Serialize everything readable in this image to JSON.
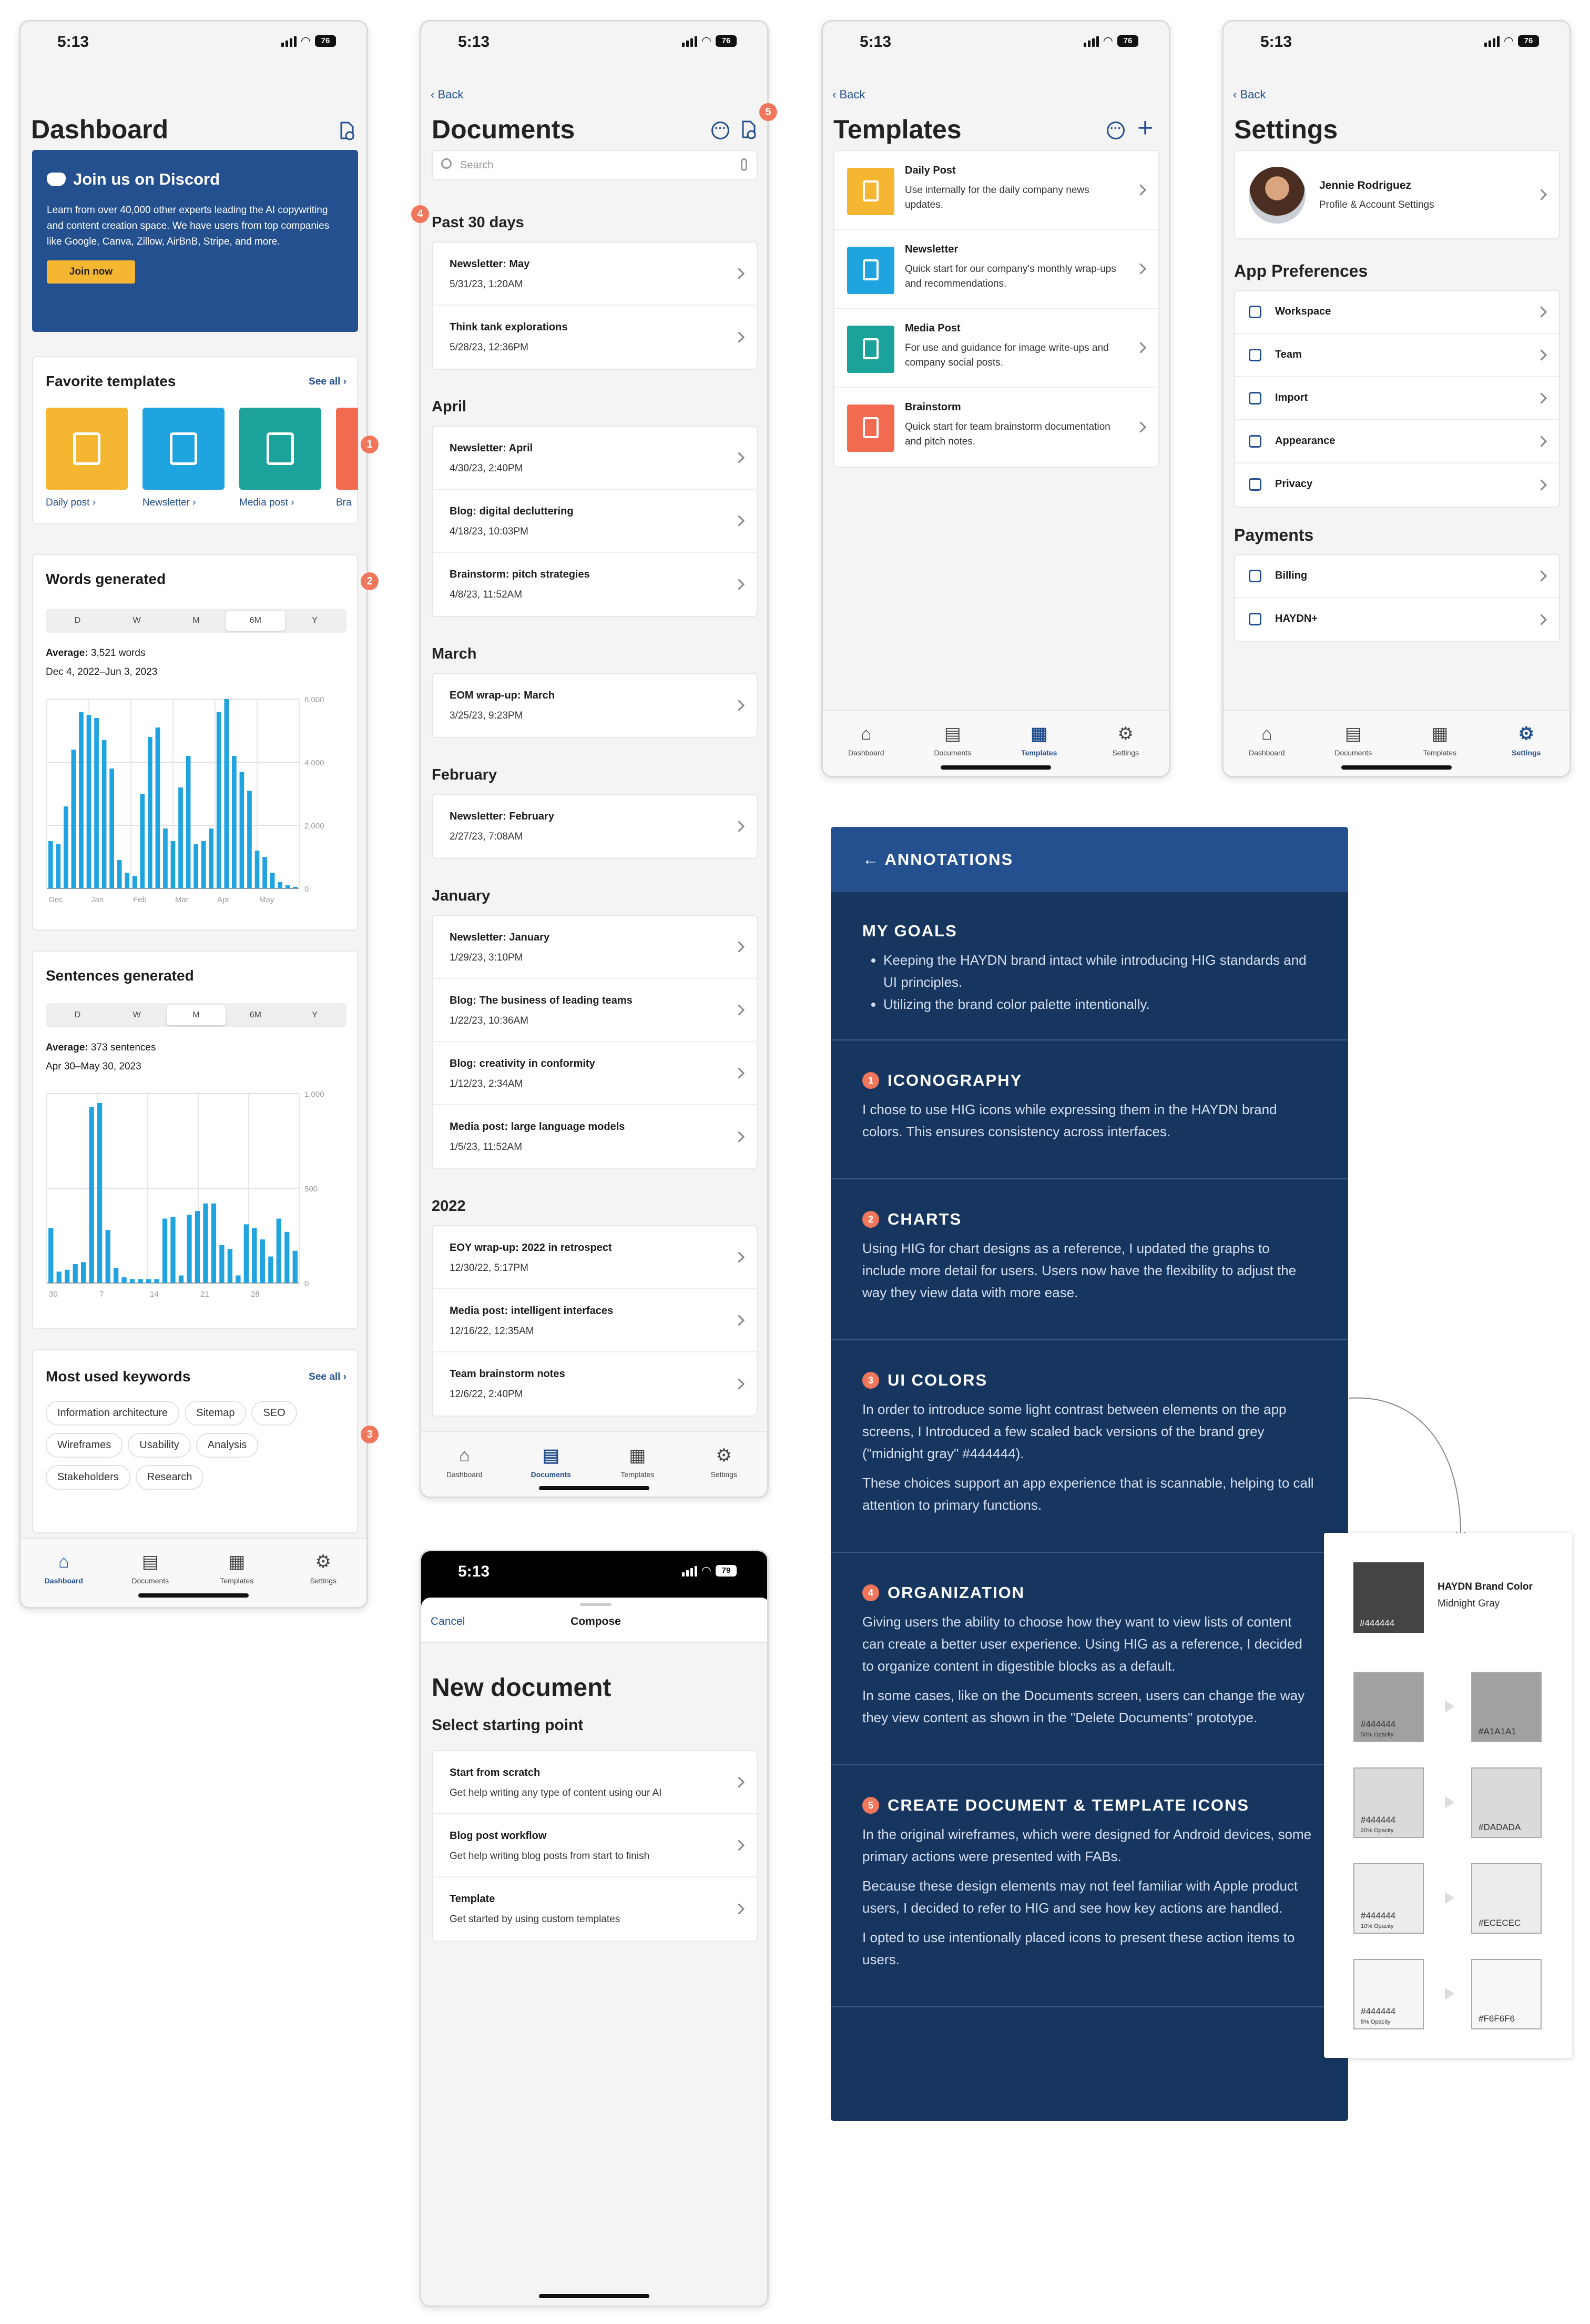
{
  "status": {
    "time": "5:13",
    "battery": "76",
    "battery_alt": "79"
  },
  "badges": [
    "1",
    "2",
    "3",
    "4",
    "5"
  ],
  "dashboard": {
    "title": "Dashboard",
    "discord": {
      "title": "Join us on Discord",
      "body": "Learn from over 40,000 other experts leading the AI copywriting and content creation space. We have users from top companies like Google, Canva, Zillow, AirBnB, Stripe, and more.",
      "button": "Join now"
    },
    "favorites": {
      "title": "Favorite templates",
      "see_all": "See all",
      "items": [
        "Daily post",
        "Newsletter",
        "Media post",
        "Bra"
      ]
    },
    "words": {
      "title": "Words generated",
      "segments": [
        "D",
        "W",
        "M",
        "6M",
        "Y"
      ],
      "selected": "6M",
      "avg_label": "Average:",
      "avg_value": "3,521 words",
      "range": "Dec 4, 2022–Jun 3, 2023"
    },
    "sentences": {
      "title": "Sentences generated",
      "segments": [
        "D",
        "W",
        "M",
        "6M",
        "Y"
      ],
      "selected": "M",
      "avg_label": "Average:",
      "avg_value": "373 sentences",
      "range": "Apr 30–May 30, 2023"
    },
    "keywords": {
      "title": "Most used keywords",
      "see_all": "See all",
      "chips": [
        "Information architecture",
        "Sitemap",
        "SEO",
        "Wireframes",
        "Usability",
        "Analysis",
        "Stakeholders",
        "Research"
      ]
    }
  },
  "tabs": [
    "Dashboard",
    "Documents",
    "Templates",
    "Settings"
  ],
  "documents": {
    "back": "Back",
    "title": "Documents",
    "search_placeholder": "Search",
    "groups": [
      {
        "title": "Past 30 days",
        "items": [
          {
            "t": "Newsletter: May",
            "d": "5/31/23, 1:20AM"
          },
          {
            "t": "Think tank explorations",
            "d": "5/28/23, 12:36PM"
          }
        ]
      },
      {
        "title": "April",
        "items": [
          {
            "t": "Newsletter: April",
            "d": "4/30/23, 2:40PM"
          },
          {
            "t": "Blog: digital decluttering",
            "d": "4/18/23, 10:03PM"
          },
          {
            "t": "Brainstorm: pitch strategies",
            "d": "4/8/23, 11:52AM"
          }
        ]
      },
      {
        "title": "March",
        "items": [
          {
            "t": "EOM wrap-up: March",
            "d": "3/25/23, 9:23PM"
          }
        ]
      },
      {
        "title": "February",
        "items": [
          {
            "t": "Newsletter: February",
            "d": "2/27/23, 7:08AM"
          }
        ]
      },
      {
        "title": "January",
        "items": [
          {
            "t": "Newsletter: January",
            "d": "1/29/23, 3:10PM"
          },
          {
            "t": "Blog: The business of leading teams",
            "d": "1/22/23, 10:36AM"
          },
          {
            "t": "Blog: creativity in conformity",
            "d": "1/12/23, 2:34AM"
          },
          {
            "t": "Media post: large language models",
            "d": "1/5/23, 11:52AM"
          }
        ]
      },
      {
        "title": "2022",
        "items": [
          {
            "t": "EOY wrap-up: 2022 in retrospect",
            "d": "12/30/22, 5:17PM"
          },
          {
            "t": "Media post: intelligent interfaces",
            "d": "12/16/22, 12:35AM"
          },
          {
            "t": "Team brainstorm notes",
            "d": "12/6/22, 2:40PM"
          }
        ]
      }
    ]
  },
  "templates": {
    "back": "Back",
    "title": "Templates",
    "items": [
      {
        "t": "Daily Post",
        "d": "Use internally for the daily company news updates.",
        "color": "#f5b731"
      },
      {
        "t": "Newsletter",
        "d": "Quick start for our company's monthly wrap-ups and recommendations.",
        "color": "#1fa4df"
      },
      {
        "t": "Media Post",
        "d": "For use and guidance for image write-ups and company social posts.",
        "color": "#1aa29b"
      },
      {
        "t": "Brainstorm",
        "d": "Quick start for team brainstorm documentation and pitch notes.",
        "color": "#f26b50"
      }
    ]
  },
  "settings": {
    "back": "Back",
    "title": "Settings",
    "profile": {
      "name": "Jennie Rodriguez",
      "sub": "Profile & Account Settings"
    },
    "prefs_title": "App Preferences",
    "prefs": [
      "Workspace",
      "Team",
      "Import",
      "Appearance",
      "Privacy"
    ],
    "payments_title": "Payments",
    "payments": [
      "Billing",
      "HAYDN+"
    ]
  },
  "newdoc": {
    "cancel": "Cancel",
    "compose": "Compose",
    "title": "New document",
    "subtitle": "Select starting point",
    "items": [
      {
        "t": "Start from scratch",
        "d": "Get help writing any type of content using our AI"
      },
      {
        "t": "Blog post workflow",
        "d": "Get help writing blog posts from start to finish"
      },
      {
        "t": "Template",
        "d": "Get started by using custom templates"
      }
    ]
  },
  "annotations": {
    "header": "← ANNOTATIONS",
    "goals_title": "MY GOALS",
    "goals": [
      "Keeping the HAYDN brand intact while introducing HIG standards and UI principles.",
      "Utilizing the brand color palette intentionally."
    ],
    "sections": [
      {
        "n": "1",
        "title": "ICONOGRAPHY",
        "paras": [
          "I chose to use HIG icons while expressing them in the HAYDN brand colors. This ensures consistency across interfaces."
        ]
      },
      {
        "n": "2",
        "title": "CHARTS",
        "paras": [
          "Using HIG for chart designs as a reference, I updated the graphs to include more detail for users. Users now have the flexibility to adjust the way they view data with more ease."
        ]
      },
      {
        "n": "3",
        "title": "UI COLORS",
        "paras": [
          "In order to introduce some light contrast between elements on the app screens, I Introduced a few scaled back versions of the brand grey (\"midnight gray\" #444444).",
          "These choices support an app experience that is scannable, helping to call attention to primary functions."
        ]
      },
      {
        "n": "4",
        "title": "ORGANIZATION",
        "paras": [
          "Giving users the ability to choose how they want to view lists of content can create a better user experience. Using HIG as a reference, I decided to organize content in digestible blocks as a default.",
          "In some cases, like on the Documents screen, users can change the way they view content as shown in the \"Delete Documents\" prototype."
        ]
      },
      {
        "n": "5",
        "title": "CREATE DOCUMENT & TEMPLATE ICONS",
        "paras": [
          "In the original wireframes, which were designed for Android devices, some primary actions were presented with FABs.",
          "Because these design elements may not feel familiar with Apple product users, I decided to refer to HIG and see how key actions are handled.",
          "I opted to use intentionally placed icons to present these action items to users."
        ]
      }
    ]
  },
  "colors": {
    "brand_title": "HAYDN Brand Color",
    "brand_sub": "Midnight Gray",
    "brand_hex": "#444444",
    "rows": [
      {
        "from": "#444444",
        "opacity": "50% Opacity",
        "to": "#A1A1A1"
      },
      {
        "from": "#444444",
        "opacity": "20% Opacity",
        "to": "#DADADA"
      },
      {
        "from": "#444444",
        "opacity": "10% Opacity",
        "to": "#ECECEC"
      },
      {
        "from": "#444444",
        "opacity": "5% Opacity",
        "to": "#F6F6F6"
      }
    ]
  },
  "chart_data": [
    {
      "type": "bar",
      "title": "Words generated",
      "x_ticks": [
        "Dec",
        "Jan",
        "Feb",
        "Mar",
        "Apr",
        "May"
      ],
      "ylim": [
        0,
        6000
      ],
      "y_ticks": [
        "6,000",
        "4,000",
        "2,000",
        "0"
      ],
      "values": [
        1500,
        1400,
        2600,
        4400,
        5600,
        5500,
        5400,
        4700,
        3800,
        900,
        500,
        400,
        3000,
        4800,
        5100,
        1900,
        1500,
        3200,
        4200,
        1400,
        1500,
        1900,
        5600,
        6000,
        4200,
        3700,
        3100,
        1200,
        1000,
        500,
        200,
        100,
        50
      ]
    },
    {
      "type": "bar",
      "title": "Sentences generated",
      "x_ticks": [
        "30",
        "7",
        "14",
        "21",
        "28"
      ],
      "ylim": [
        0,
        1000
      ],
      "y_ticks": [
        "1,000",
        "500",
        "0"
      ],
      "values": [
        290,
        60,
        70,
        100,
        110,
        930,
        950,
        280,
        80,
        30,
        20,
        20,
        20,
        20,
        340,
        350,
        40,
        360,
        380,
        420,
        420,
        200,
        180,
        40,
        310,
        290,
        230,
        140,
        340,
        270,
        170
      ]
    }
  ]
}
